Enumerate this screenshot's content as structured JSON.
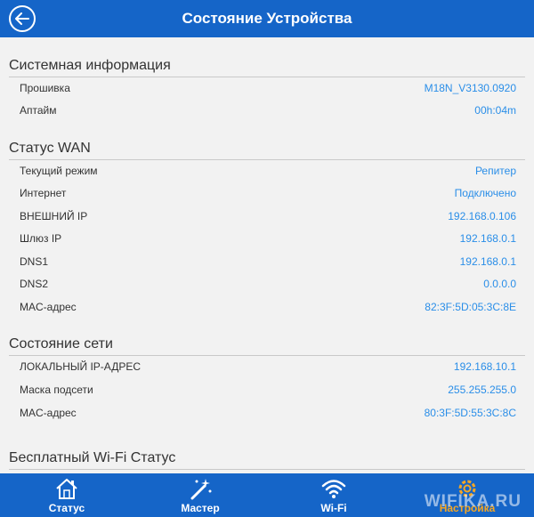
{
  "header": {
    "title": "Состояние Устройства"
  },
  "sections": [
    {
      "title": "Системная информация",
      "rows": [
        {
          "label": "Прошивка",
          "value": "M18N_V3130.0920"
        },
        {
          "label": "Аптайм",
          "value": "00h:04m"
        }
      ]
    },
    {
      "title": "Статус WAN",
      "rows": [
        {
          "label": "Текущий режим",
          "value": "Репитер"
        },
        {
          "label": "Интернет",
          "value": "Подключено"
        },
        {
          "label": "ВНЕШНИЙ IP",
          "value": "192.168.0.106"
        },
        {
          "label": "Шлюз IP",
          "value": "192.168.0.1"
        },
        {
          "label": "DNS1",
          "value": "192.168.0.1"
        },
        {
          "label": "DNS2",
          "value": "0.0.0.0"
        },
        {
          "label": "MAC-адрес",
          "value": "82:3F:5D:05:3C:8E"
        }
      ]
    },
    {
      "title": "Состояние сети",
      "rows": [
        {
          "label": "ЛОКАЛЬНЫЙ IP-АДРЕС",
          "value": "192.168.10.1"
        },
        {
          "label": "Маска подсети",
          "value": "255.255.255.0"
        },
        {
          "label": "MAC-адрес",
          "value": "80:3F:5D:55:3C:8C"
        }
      ]
    },
    {
      "title": "Бесплатный Wi-Fi Статус",
      "rows": []
    }
  ],
  "tabs": [
    {
      "label": "Статус",
      "icon": "home-icon"
    },
    {
      "label": "Мастер",
      "icon": "magic-wand-icon"
    },
    {
      "label": "Wi-Fi",
      "icon": "wifi-icon"
    },
    {
      "label": "Настройка",
      "icon": "gear-icon"
    }
  ],
  "watermark": "WIFIKA.RU",
  "colors": {
    "header": "#1565c8",
    "value": "#2a8ee8",
    "active_tab": "#f5a623"
  }
}
